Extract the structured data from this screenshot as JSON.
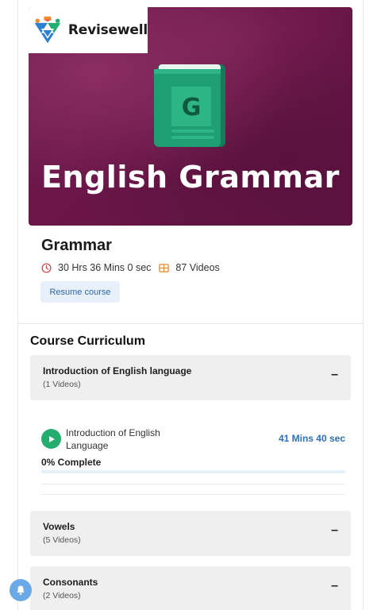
{
  "brand": {
    "name": "Revisewell"
  },
  "hero": {
    "title": "English Grammar",
    "book_letter": "G"
  },
  "course": {
    "title": "Grammar",
    "duration": "30 Hrs 36 Mins 0 sec",
    "videos": "87 Videos",
    "resume_label": "Resume course"
  },
  "curriculum": {
    "title": "Course Curriculum",
    "sections": [
      {
        "name": "Introduction of English language",
        "count": "(1 Videos)",
        "toggle": "–"
      },
      {
        "name": "Vowels",
        "count": "(5 Videos)",
        "toggle": "–"
      },
      {
        "name": "Consonants",
        "count": "(2 Videos)",
        "toggle": "–"
      }
    ],
    "lesson": {
      "title": "Introduction of English Language",
      "duration": "41 Mins 40 sec",
      "progress_label": "0% Complete",
      "progress_fraction": 0
    }
  },
  "colors": {
    "accent_blue": "#2f6fb8",
    "play_green": "#23ad6e",
    "hero_bg": "#6a1648",
    "book_green": "#1f9e74"
  },
  "icons": [
    "clock-icon",
    "video-grid-icon",
    "play-icon",
    "bell-icon",
    "book-icon"
  ]
}
